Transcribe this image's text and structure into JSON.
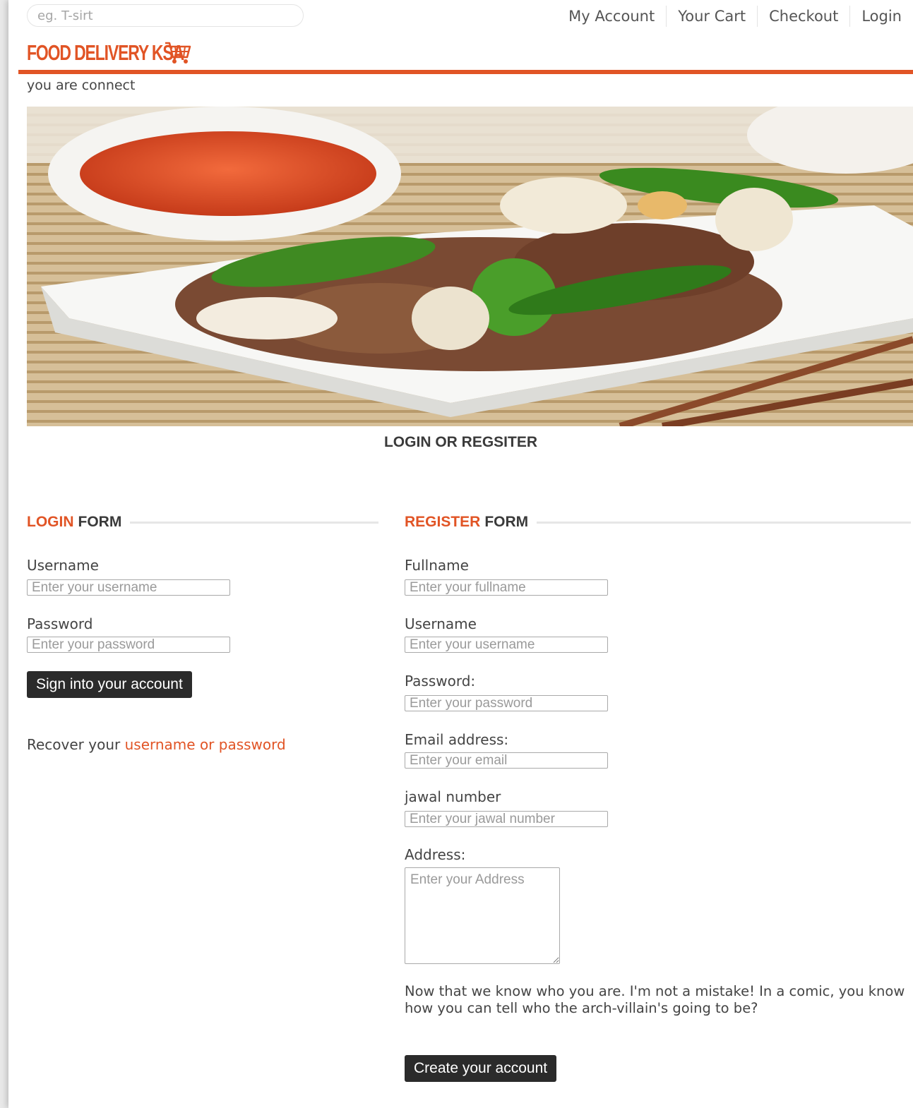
{
  "header": {
    "search_placeholder": "eg. T-sirt",
    "nav": [
      "My Account",
      "Your Cart",
      "Checkout",
      "Login"
    ]
  },
  "brand": {
    "logo_text": "FOOD DELIVERY KSA",
    "logo_icon": "shopping-cart-icon",
    "accent_color": "#e15425"
  },
  "status_text": "you are connect",
  "hero": {
    "image": "plate of beef and green pepper stir-fry with sauce bowl and chopsticks"
  },
  "section_title": "LOGIN OR REGSITER",
  "login_form": {
    "heading_accent": "LOGIN",
    "heading_rest": "FORM",
    "username_label": "Username",
    "username_placeholder": "Enter your username",
    "password_label": "Password",
    "password_placeholder": "Enter your password",
    "submit_label": "Sign into your account",
    "recover_prefix": "Recover your",
    "recover_link": "username or password"
  },
  "register_form": {
    "heading_accent": "REGISTER",
    "heading_rest": "FORM",
    "fullname_label": "Fullname",
    "fullname_placeholder": "Enter your fullname",
    "username_label": "Username",
    "username_placeholder": "Enter your username",
    "password_label": "Password:",
    "password_placeholder": "Enter your password",
    "email_label": "Email address:",
    "email_placeholder": "Enter your email",
    "jawal_label": "jawal number",
    "jawal_placeholder": "Enter your jawal number",
    "address_label": "Address:",
    "address_placeholder": "Enter your Address",
    "note": "Now that we know who you are. I'm not a mistake! In a comic, you know how you can tell who the arch-villain's going to be?",
    "submit_label": "Create your account"
  }
}
